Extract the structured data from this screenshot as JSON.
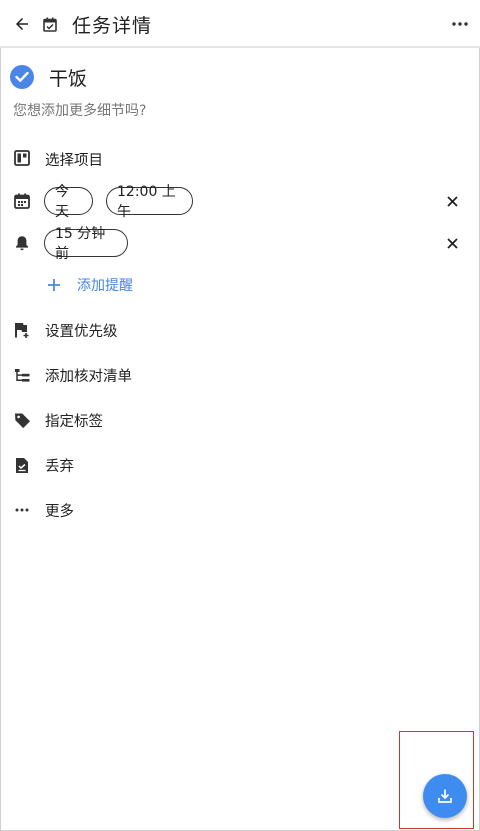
{
  "appbar": {
    "title": "任务详情"
  },
  "task": {
    "title": "干饭",
    "description_placeholder": "您想添加更多细节吗?",
    "completed": true
  },
  "rows": {
    "project_label": "选择项目",
    "date_chip": "今天",
    "time_chip": "12:00 上午",
    "reminder_chip": "15 分钟前",
    "add_reminder_label": "添加提醒",
    "priority_label": "设置优先级",
    "checklist_label": "添加核对清单",
    "tags_label": "指定标签",
    "discard_label": "丢弃",
    "more_label": "更多"
  },
  "icons": {
    "back": "arrow-left-icon",
    "calendar_check": "calendar-check-icon",
    "more": "more-horizontal-icon",
    "task_check": "check-circle-icon",
    "project": "project-board-icon",
    "calendar": "calendar-icon",
    "bell": "bell-icon",
    "plus": "plus-icon",
    "flag_plus": "flag-plus-icon",
    "checklist": "checklist-tree-icon",
    "tag": "tag-icon",
    "discard": "discard-file-icon",
    "ellipsis": "ellipsis-icon",
    "download": "download-icon"
  },
  "colors": {
    "accent": "#4a86e8",
    "fab": "#3f8cf0",
    "highlight": "#d0342c",
    "text_primary": "#212121",
    "text_secondary": "#777777"
  }
}
